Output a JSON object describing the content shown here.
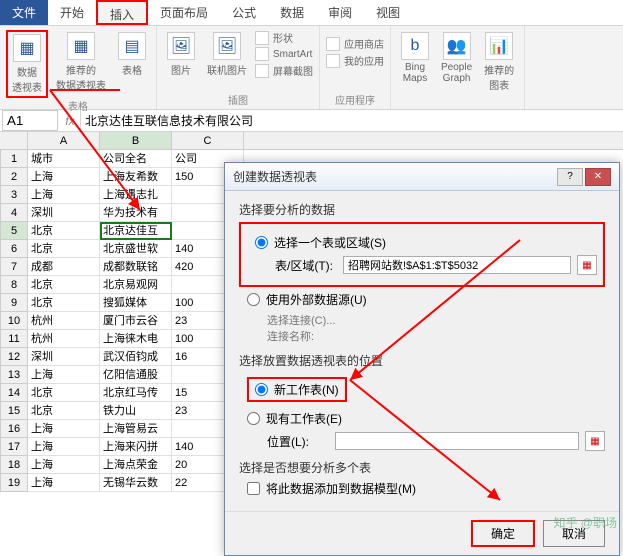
{
  "tabs": {
    "file": "文件",
    "home": "开始",
    "insert": "插入",
    "layout": "页面布局",
    "formulas": "公式",
    "data": "数据",
    "review": "审阅",
    "view": "视图"
  },
  "ribbon": {
    "pivot": "数据\n透视表",
    "recommended": "推荐的\n数据透视表",
    "tables_group": "表格",
    "table": "表格",
    "picture": "图片",
    "online_pic": "联机图片",
    "shapes": "形状",
    "smartart": "SmartArt",
    "screenshot": "屏幕截图",
    "illustrations_group": "插图",
    "app_store": "应用商店",
    "my_apps": "我的应用",
    "apps_group": "应用程序",
    "bing": "Bing\nMaps",
    "people": "People\nGraph",
    "rec_charts": "推荐的\n图表"
  },
  "formula_bar": {
    "name": "A1",
    "value": "北京达佳互联信息技术有限公司"
  },
  "columns": [
    "A",
    "B",
    "C"
  ],
  "headers": [
    "城市",
    "公司全名",
    "公司"
  ],
  "rows": [
    {
      "n": 1,
      "c": [
        "城市",
        "公司全名",
        "公司"
      ]
    },
    {
      "n": 2,
      "c": [
        "上海",
        "上海友希数",
        "150"
      ]
    },
    {
      "n": 3,
      "c": [
        "上海",
        "上海遇志扎",
        ""
      ]
    },
    {
      "n": 4,
      "c": [
        "深圳",
        "华为技术有",
        ""
      ]
    },
    {
      "n": 5,
      "c": [
        "北京",
        "北京达佳互",
        ""
      ]
    },
    {
      "n": 6,
      "c": [
        "北京",
        "北京盛世软",
        "140"
      ]
    },
    {
      "n": 7,
      "c": [
        "成都",
        "成都数联铭",
        "420"
      ]
    },
    {
      "n": 8,
      "c": [
        "北京",
        "北京易观网",
        ""
      ]
    },
    {
      "n": 9,
      "c": [
        "北京",
        "搜狐媒体",
        "100"
      ]
    },
    {
      "n": 10,
      "c": [
        "杭州",
        "厦门市云谷",
        "23"
      ]
    },
    {
      "n": 11,
      "c": [
        "杭州",
        "上海徕木电",
        "100"
      ]
    },
    {
      "n": 12,
      "c": [
        "深圳",
        "武汉佰钧成",
        "16"
      ]
    },
    {
      "n": 13,
      "c": [
        "上海",
        "亿阳信通股",
        ""
      ]
    },
    {
      "n": 14,
      "c": [
        "北京",
        "北京红马传",
        "15"
      ]
    },
    {
      "n": 15,
      "c": [
        "北京",
        "铁力山",
        "23"
      ]
    },
    {
      "n": 16,
      "c": [
        "上海",
        "上海管易云",
        ""
      ]
    },
    {
      "n": 17,
      "c": [
        "上海",
        "上海来闪拼",
        "140"
      ]
    },
    {
      "n": 18,
      "c": [
        "上海",
        "上海点荣金",
        "20"
      ]
    },
    {
      "n": 19,
      "c": [
        "上海",
        "无锡华云数",
        "22"
      ]
    }
  ],
  "dialog": {
    "title": "创建数据透视表",
    "section1": "选择要分析的数据",
    "opt_select": "选择一个表或区域(S)",
    "field_range": "表/区域(T):",
    "range_value": "招聘网站数!$A$1:$T$5032",
    "opt_external": "使用外部数据源(U)",
    "choose_conn": "选择连接(C)...",
    "conn_name": "连接名称:",
    "section2": "选择放置数据透视表的位置",
    "opt_new": "新工作表(N)",
    "opt_existing": "现有工作表(E)",
    "field_loc": "位置(L):",
    "section3": "选择是否想要分析多个表",
    "chk_model": "将此数据添加到数据模型(M)",
    "ok": "确定",
    "cancel": "取消"
  },
  "watermark": "知乎 @职场"
}
